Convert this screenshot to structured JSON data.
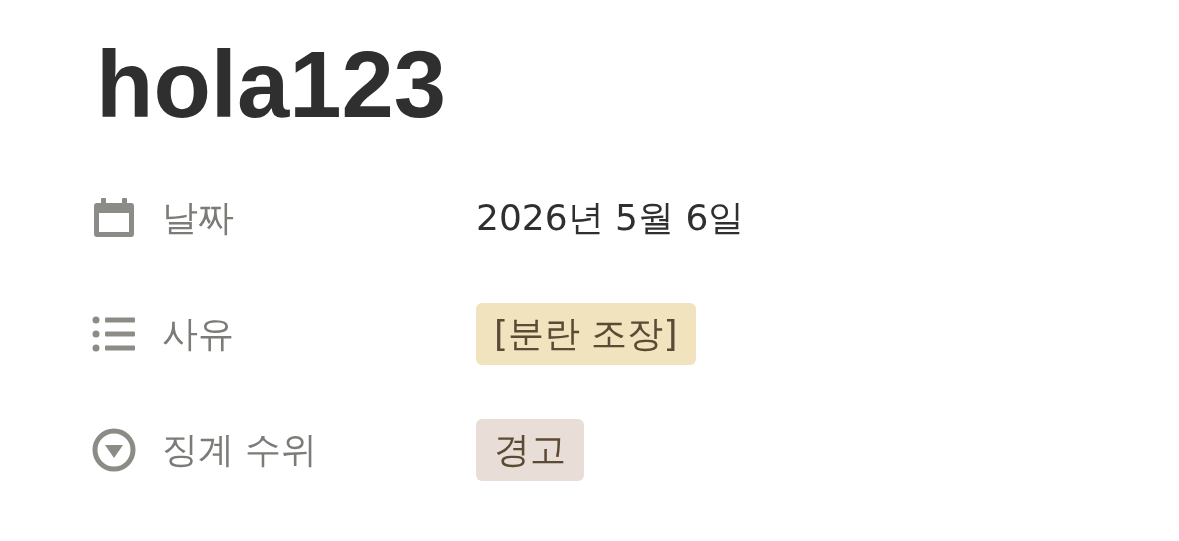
{
  "title": "hola123",
  "properties": [
    {
      "kind": "date",
      "label": "날짜",
      "value": "2026년 5월 6일"
    },
    {
      "kind": "multi_select",
      "label": "사유",
      "tags": [
        {
          "text": "[분란 조장]",
          "color": "#f0e3bd"
        }
      ]
    },
    {
      "kind": "select",
      "label": "징계 수위",
      "tags": [
        {
          "text": "경고",
          "color": "#e9ded7"
        }
      ]
    }
  ]
}
